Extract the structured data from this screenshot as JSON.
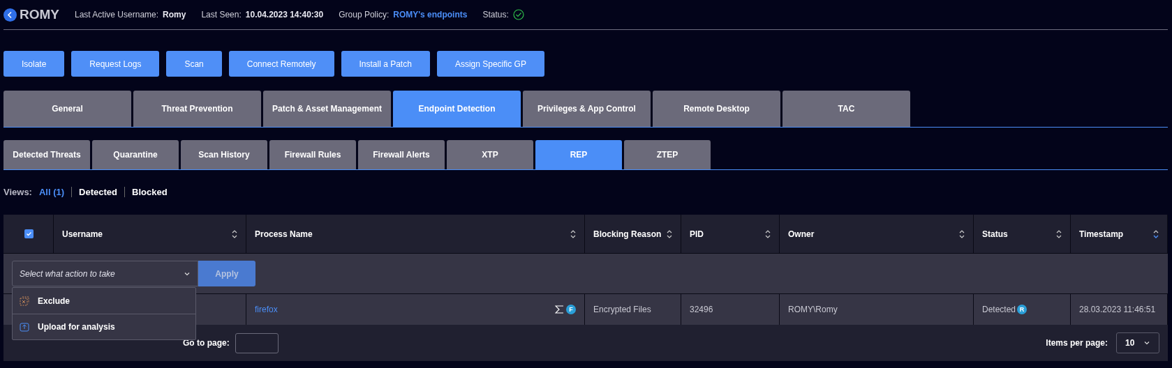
{
  "header": {
    "title": "ROMY",
    "fields": [
      {
        "label": "Last Active Username:",
        "value": "Romy",
        "kind": "text"
      },
      {
        "label": "Last Seen:",
        "value": "10.04.2023  14:40:30",
        "kind": "text"
      },
      {
        "label": "Group Policy:",
        "value": "ROMY's endpoints",
        "kind": "link"
      },
      {
        "label": "Status:",
        "kind": "status",
        "ok": true
      }
    ]
  },
  "actions": [
    "Isolate",
    "Request Logs",
    "Scan",
    "Connect Remotely",
    "Install a Patch",
    "Assign Specific GP"
  ],
  "tabs": [
    {
      "label": "General",
      "selected": false
    },
    {
      "label": "Threat Prevention",
      "selected": false
    },
    {
      "label": "Patch & Asset Management",
      "selected": false
    },
    {
      "label": "Endpoint Detection",
      "selected": true
    },
    {
      "label": "Privileges & App Control",
      "selected": false
    },
    {
      "label": "Remote Desktop",
      "selected": false
    },
    {
      "label": "TAC",
      "selected": false
    }
  ],
  "subtabs": [
    {
      "label": "Detected Threats",
      "selected": false
    },
    {
      "label": "Quarantine",
      "selected": false
    },
    {
      "label": "Scan History",
      "selected": false
    },
    {
      "label": "Firewall Rules",
      "selected": false
    },
    {
      "label": "Firewall Alerts",
      "selected": false
    },
    {
      "label": "XTP",
      "selected": false
    },
    {
      "label": "REP",
      "selected": true
    },
    {
      "label": "ZTEP",
      "selected": false
    }
  ],
  "views": {
    "label": "Views:",
    "items": [
      {
        "label": "All (1)",
        "selected": true
      },
      {
        "label": "Detected",
        "selected": false
      },
      {
        "label": "Blocked",
        "selected": false
      }
    ]
  },
  "table": {
    "select_all": {
      "checked": true
    },
    "columns": [
      {
        "label": "Username",
        "sorted": false
      },
      {
        "label": "Process Name",
        "sorted": false
      },
      {
        "label": "Blocking Reason",
        "sorted": false
      },
      {
        "label": "PID",
        "sorted": false
      },
      {
        "label": "Owner",
        "sorted": false
      },
      {
        "label": "Status",
        "sorted": false
      },
      {
        "label": "Timestamp",
        "sorted": true
      }
    ],
    "action_select": {
      "placeholder": "Select what action to take",
      "button": "Apply",
      "menu": [
        {
          "label": "Exclude",
          "kind": "exclude"
        },
        {
          "label": "Upload for analysis",
          "kind": "upload"
        }
      ]
    },
    "rows": [
      {
        "process": "firefox",
        "process_badge": "F",
        "blocking_reason": "Encrypted Files",
        "pid": "32496",
        "owner": "ROMY\\Romy",
        "status": "Detected",
        "status_badge": "R",
        "timestamp": "28.03.2023  11:46:51"
      }
    ]
  },
  "footer": {
    "goto_label": "Go to page:",
    "items_label": "Items per page:",
    "items_value": "10"
  }
}
